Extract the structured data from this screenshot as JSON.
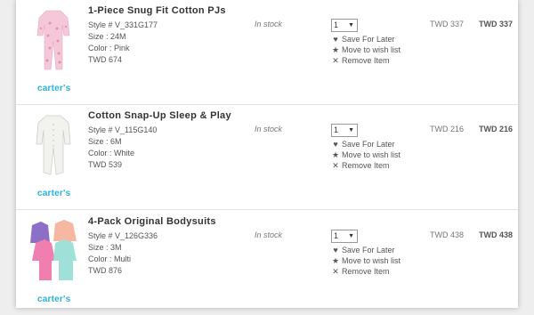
{
  "cart": {
    "items": [
      {
        "title": "1-Piece Snug Fit Cotton PJs",
        "style": "Style # V_331G177",
        "size": "Size : 24M",
        "color": "Color : Pink",
        "unit_price": "TWD 674",
        "brand": "carter's",
        "stock": "In stock",
        "qty": "1",
        "save_label": "Save For Later",
        "wish_label": "Move to wish list",
        "remove_label": "Remove Item",
        "price": "TWD 337",
        "total": "TWD 337"
      },
      {
        "title": "Cotton Snap-Up Sleep & Play",
        "style": "Style # V_115G140",
        "size": "Size : 6M",
        "color": "Color : White",
        "unit_price": "TWD 539",
        "brand": "carter's",
        "stock": "In stock",
        "qty": "1",
        "save_label": "Save For Later",
        "wish_label": "Move to wish list",
        "remove_label": "Remove Item",
        "price": "TWD 216",
        "total": "TWD 216"
      },
      {
        "title": "4-Pack Original Bodysuits",
        "style": "Style # V_126G336",
        "size": "Size : 3M",
        "color": "Color : Multi",
        "unit_price": "TWD 876",
        "brand": "carter's",
        "stock": "In stock",
        "qty": "1",
        "save_label": "Save For Later",
        "wish_label": "Move to wish list",
        "remove_label": "Remove Item",
        "price": "TWD 438",
        "total": "TWD 438"
      }
    ]
  },
  "icons": {
    "save": "heart-icon",
    "wish": "star-icon",
    "remove": "close-icon",
    "qty_arrow": "chevron-down-icon"
  },
  "colors": {
    "brand": "#2ab0d8",
    "pink_pj": "#f4c8d8",
    "white_pj": "#f2f2ee",
    "bodysuit_purple": "#8c6fc6",
    "bodysuit_pink": "#f07fb0",
    "bodysuit_peach": "#f6b8a0",
    "bodysuit_mint": "#9fe0d8"
  }
}
